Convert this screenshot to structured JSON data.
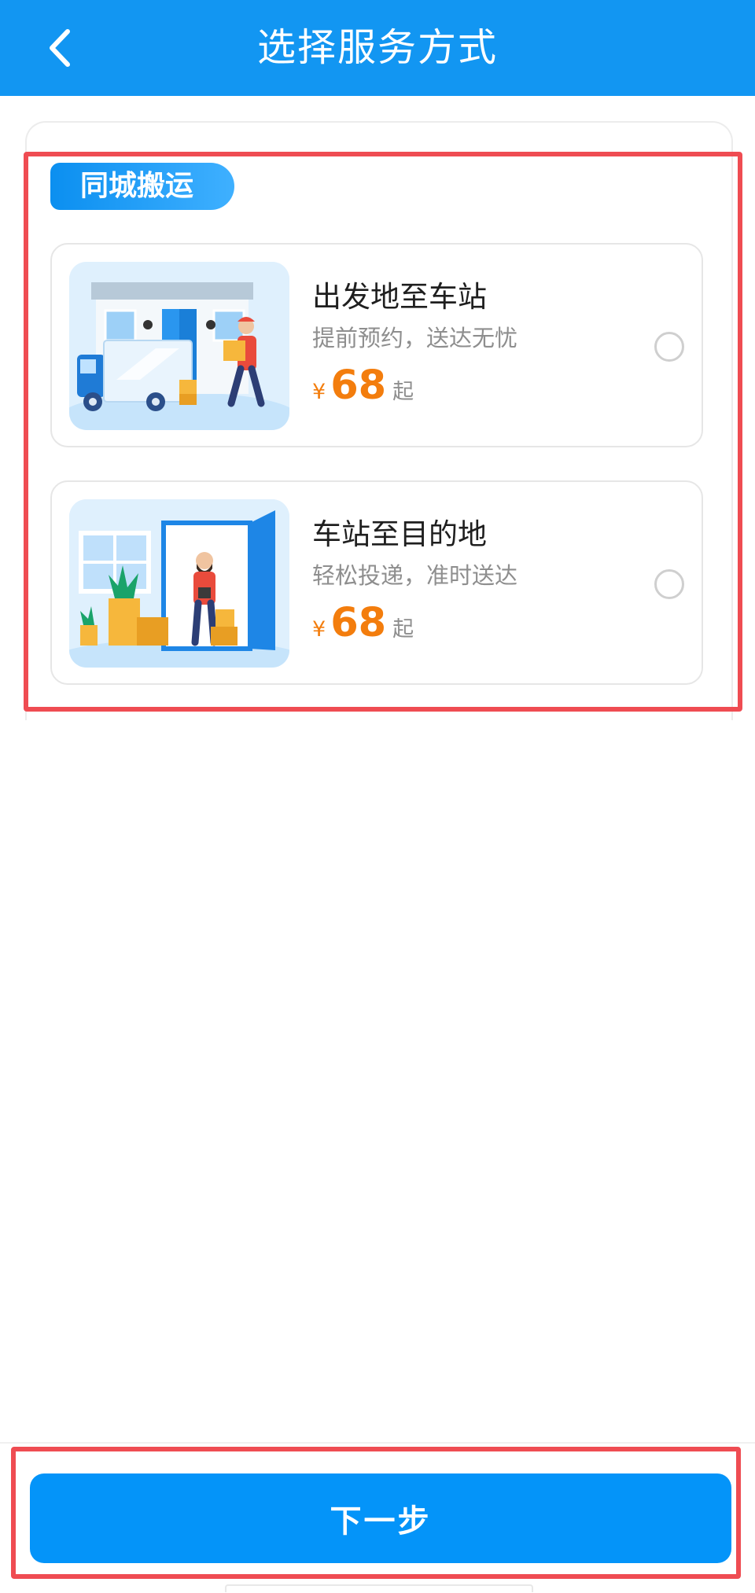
{
  "header": {
    "title": "选择服务方式",
    "back_icon": "chevron-left-icon"
  },
  "section": {
    "badge": "同城搬运"
  },
  "options": [
    {
      "title": "出发地至车站",
      "subtitle": "提前预约，送达无忧",
      "currency": "¥",
      "price": "68",
      "suffix": "起",
      "selected": false,
      "image": "moving-truck-illustration"
    },
    {
      "title": "车站至目的地",
      "subtitle": "轻松投递，准时送达",
      "currency": "¥",
      "price": "68",
      "suffix": "起",
      "selected": false,
      "image": "delivery-doorway-illustration"
    }
  ],
  "footer": {
    "next_label": "下一步"
  },
  "colors": {
    "primary": "#1296f2",
    "button": "#0494f9",
    "price": "#f37d0d",
    "highlight": "#ef4c52"
  }
}
